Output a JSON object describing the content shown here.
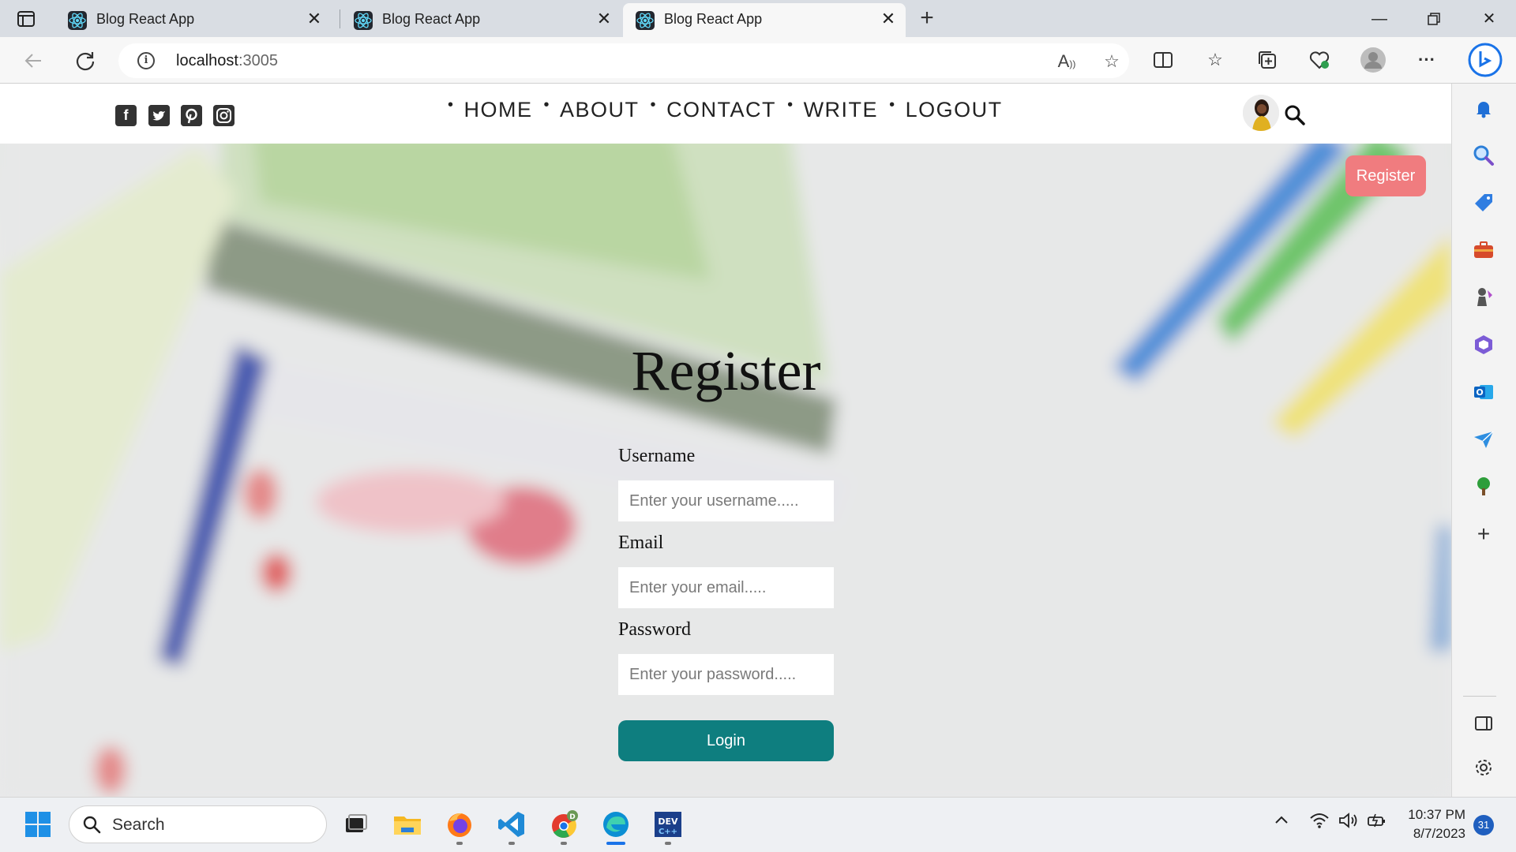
{
  "browser": {
    "tabs": [
      {
        "title": "Blog React App",
        "active": false
      },
      {
        "title": "Blog React App",
        "active": false
      },
      {
        "title": "Blog React App",
        "active": true
      }
    ],
    "url_host": "localhost",
    "url_port": ":3005"
  },
  "page": {
    "nav": {
      "items": [
        "HOME",
        "ABOUT",
        "CONTACT",
        "WRITE",
        "LOGOUT"
      ]
    },
    "register_link": "Register",
    "form": {
      "title": "Register",
      "username_label": "Username",
      "username_placeholder": "Enter your username.....",
      "email_label": "Email",
      "email_placeholder": "Enter your email.....",
      "password_label": "Password",
      "password_placeholder": "Enter your password.....",
      "submit_label": "Login"
    },
    "colors": {
      "register_link_bg": "#f07c7f",
      "submit_bg": "#0e7e7f"
    }
  },
  "taskbar": {
    "search_label": "Search",
    "time": "10:37 PM",
    "date": "8/7/2023",
    "notification_count": "31"
  }
}
